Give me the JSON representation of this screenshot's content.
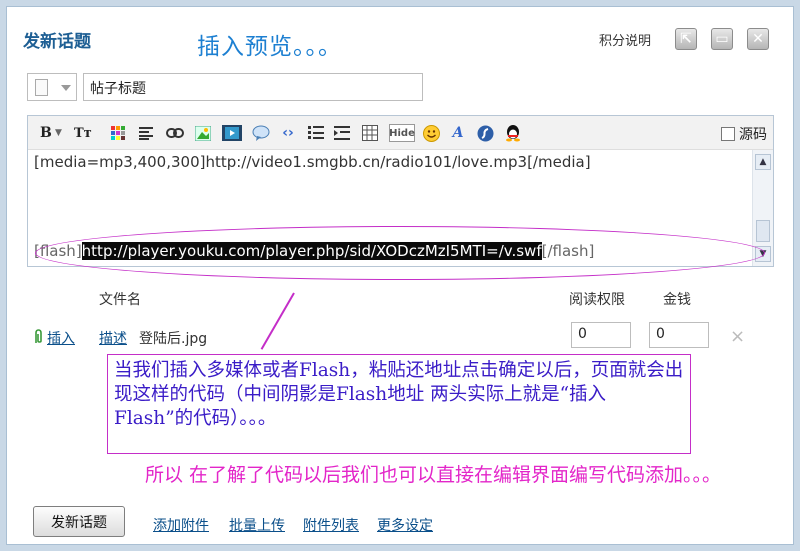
{
  "dialog": {
    "title": "发新话题",
    "top_note": "插入预览。。。",
    "rules_link": "积分说明",
    "window_buttons": [
      {
        "name": "pop-out-icon",
        "glyph": "⇱"
      },
      {
        "name": "maximize-icon",
        "glyph": "▭"
      },
      {
        "name": "close-icon",
        "glyph": "✕"
      }
    ]
  },
  "subject": {
    "value": "帖子标题",
    "type_icon": "document-icon"
  },
  "toolbar": {
    "icons": [
      "bold-icon",
      "font-size-icon",
      "color-grid-icon",
      "align-icon",
      "link-icon",
      "image-icon",
      "media-icon",
      "quote-icon",
      "code-icon",
      "ordered-list-icon",
      "indent-icon",
      "table-icon",
      "hide-icon",
      "smiley-icon",
      "font-icon",
      "flash-icon",
      "qq-icon"
    ],
    "bold_label": "B",
    "fontsize_label": "Tт",
    "hide_label": "Hide",
    "source_label": "源码"
  },
  "editor": {
    "line1": "[media=mp3,400,300]http://video1.smgbb.cn/radio101/love.mp3[/media]",
    "line2_open": "[flash]",
    "line2_url": "http://player.youku.com/player.php/sid/XODczMzI5MTI=/v.swf",
    "line2_close": "[/flash]"
  },
  "attachments": {
    "header_filename": "文件名",
    "header_permission": "阅读权限",
    "header_price": "金钱",
    "rows": [
      {
        "insert": "插入",
        "describe": "描述",
        "filename": "登陆后.jpg",
        "permission": "0",
        "price": "0"
      }
    ]
  },
  "annotations": {
    "callout": "当我们插入多媒体或者Flash，粘贴还地址点击确定以后，页面就会出现这样的代码（中间阴影是Flash地址 两头实际上就是“插入Flash”的代码）。。。",
    "bottom_note": "所以 在了解了代码以后我们也可以直接在编辑界面编写代码添加。。。"
  },
  "footer": {
    "submit_label": "发新话题",
    "links": [
      "添加附件",
      "批量上传",
      "附件列表",
      "更多设定"
    ]
  }
}
